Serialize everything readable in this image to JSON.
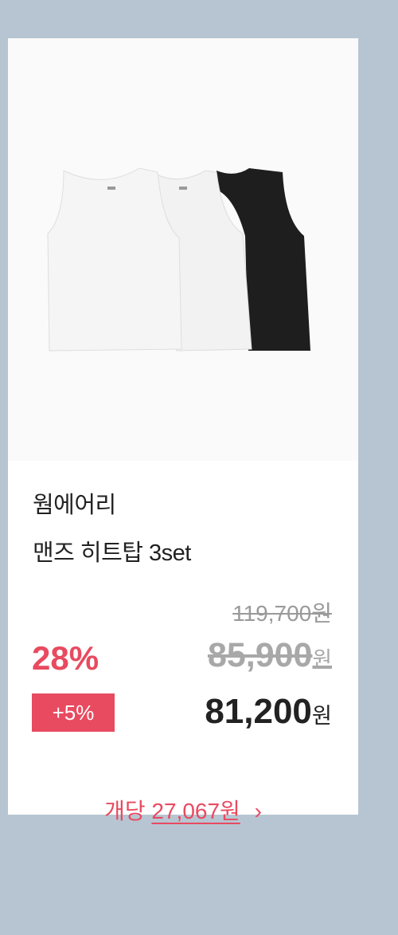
{
  "product": {
    "brand": "웜에어리",
    "title": "맨즈 히트탑 3set",
    "image_alt": "white and black sleeveless tops set"
  },
  "pricing": {
    "original_price": "119,700",
    "original_unit": "원",
    "sale_price": "85,900",
    "sale_unit": "원",
    "final_price": "81,200",
    "final_unit": "원",
    "discount_rate": "28%",
    "extra_discount": "+5%"
  },
  "per_unit": {
    "prefix": "개당",
    "amount": "27,067원",
    "chevron": "›"
  },
  "colors": {
    "accent": "#e84a60",
    "background": "#b7c5d2"
  }
}
